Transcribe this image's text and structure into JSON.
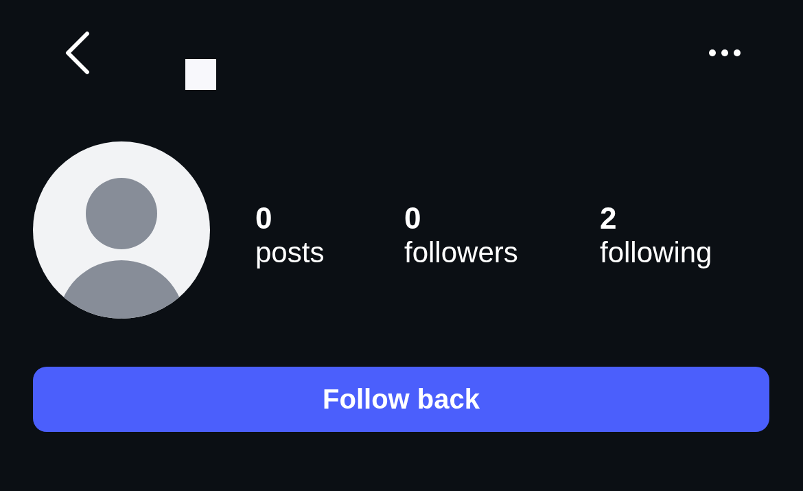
{
  "profile": {
    "stats": [
      {
        "value": "0",
        "label": "posts"
      },
      {
        "value": "0",
        "label": "followers"
      },
      {
        "value": "2",
        "label": "following"
      }
    ]
  },
  "follow_button": {
    "label": "Follow back"
  }
}
